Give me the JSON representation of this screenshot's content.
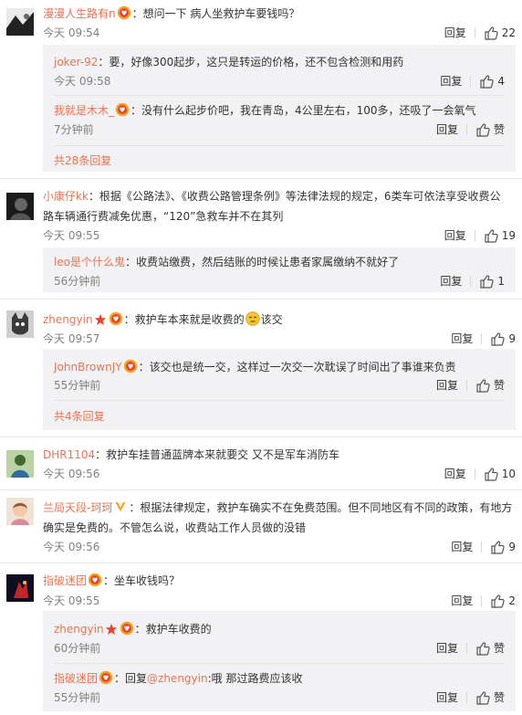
{
  "ops": {
    "reply": "回复",
    "like_word": "赞"
  },
  "comments": [
    {
      "name": "漫漫人生路有n",
      "text": "：想问一下  病人坐救护车要钱吗？",
      "time": "今天 09:54",
      "likes": "22",
      "replies": [
        {
          "name": "joker-92",
          "text": "：要，好像300起步，这只是转运的价格，还不包含检测和用药",
          "time": "今天 09:58",
          "likes": "4"
        },
        {
          "name": "我就是木木_",
          "text": "：没有什么起步价吧，我在青岛，4公里左右，100多，还吸了一会氧气",
          "time": "7分钟前",
          "likes": "赞"
        }
      ],
      "more": "共28条回复"
    },
    {
      "name": "小康仔kk",
      "text": "：根据《公路法》、《收费公路管理条例》等法律法规的规定，6类车可依法享受收费公",
      "text2": "路车辆通行费减免优惠，“120”急救车并不在其列",
      "time": "今天 09:55",
      "likes": "19",
      "replies": [
        {
          "name": "leo是个什么鬼",
          "text": "：收费站缴费，然后结账的时候让患者家属缴纳不就好了",
          "time": "56分钟前",
          "likes": "1"
        }
      ]
    },
    {
      "name": "zhengyin",
      "text": "：救护车本来就是收费的",
      "text_after": "该交",
      "time": "今天 09:57",
      "likes": "9",
      "replies": [
        {
          "name": "JohnBrownJY",
          "text": "：该交也是统一交，这样过一次交一次耽误了时间出了事谁来负责",
          "time": "55分钟前",
          "likes": "赞"
        }
      ],
      "more": "共4条回复"
    },
    {
      "name": "DHR1104",
      "text": "：救护车挂普通蓝牌本来就要交 又不是军车消防车",
      "time": "今天 09:56",
      "likes": "10"
    },
    {
      "name": "兰局天段-珂珂",
      "text": "：根据法律规定，救护车确实不在免费范围。但不同地区有不同的政策，有地方",
      "text2": "确实是免费的。不管怎么说，收费站工作人员做的没错",
      "time": "今天 09:56",
      "likes": "9"
    },
    {
      "name": "指破迷团",
      "text": "：坐车收钱吗？",
      "time": "今天 09:55",
      "likes": "2",
      "replies": [
        {
          "name": "zhengyin",
          "text": "：救护车收费的",
          "time": "60分钟前",
          "likes": "赞"
        },
        {
          "name": "指破迷团",
          "text": "：回复",
          "mention": "@zhengyin",
          "text_after": ":哦 那过路费应该收",
          "time": "55分钟前",
          "likes": "赞"
        }
      ]
    }
  ]
}
